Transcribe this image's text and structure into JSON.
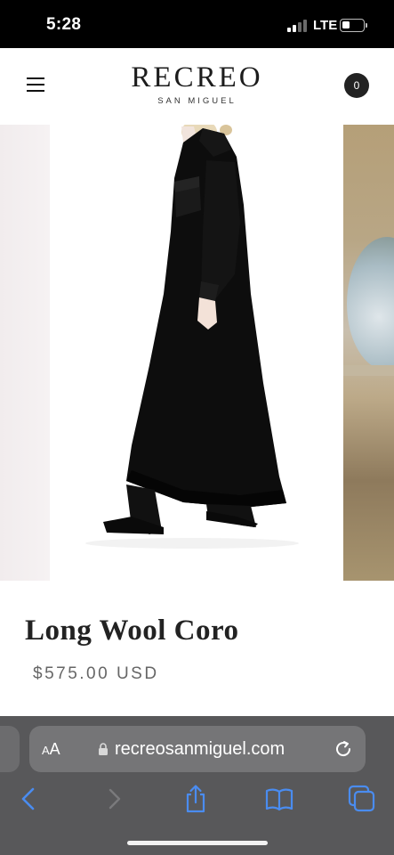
{
  "status_bar": {
    "time": "5:28",
    "network": "LTE",
    "battery_level": 0.35,
    "signal_bars_active": 2
  },
  "header": {
    "logo_main": "RECREO",
    "logo_sub": "SAN MIGUEL",
    "cart_count": "0",
    "menu_icon": "hamburger-icon"
  },
  "product": {
    "title": "Long Wool Coro",
    "price": "$575.00 USD"
  },
  "browser": {
    "text_size_label_small": "A",
    "text_size_label_large": "A",
    "url": "recreosanmiguel.com",
    "icons": [
      "lock-icon",
      "reload-icon",
      "back-icon",
      "forward-icon",
      "share-icon",
      "bookmarks-icon",
      "tabs-icon"
    ]
  },
  "colors": {
    "accent_blue": "#4a8cf0",
    "toolbar_bg": "#58585a",
    "url_pill_bg": "#757577"
  }
}
